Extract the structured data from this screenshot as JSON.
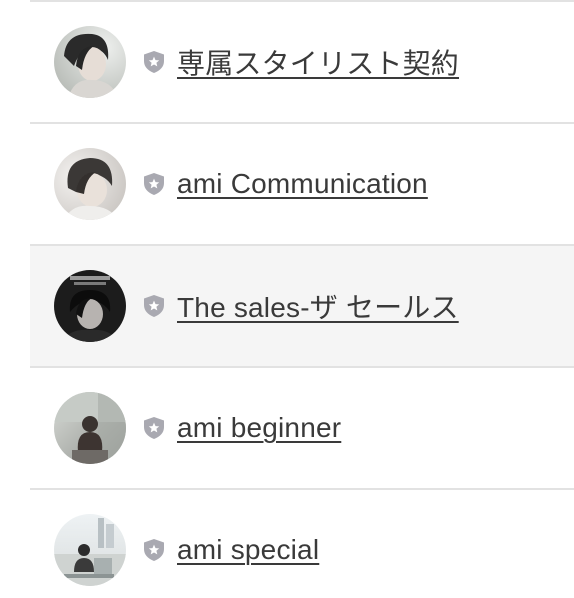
{
  "items": [
    {
      "title": "専属スタイリスト契約",
      "badge_icon": "shield-star-icon",
      "avatar": "person-portrait-light"
    },
    {
      "title": "ami Communication",
      "badge_icon": "shield-star-icon",
      "avatar": "person-portrait-soft"
    },
    {
      "title": "The sales-ザ セールス",
      "badge_icon": "shield-star-icon",
      "avatar": "book-cover-portrait"
    },
    {
      "title": "ami beginner",
      "badge_icon": "shield-star-icon",
      "avatar": "person-seated-window"
    },
    {
      "title": "ami special",
      "badge_icon": "shield-star-icon",
      "avatar": "person-outdoor-city"
    }
  ],
  "colors": {
    "divider": "#e2e2e2",
    "highlight_row": "#f5f5f5",
    "title_text": "#3a3a3a",
    "badge": "#a9a9b1"
  }
}
